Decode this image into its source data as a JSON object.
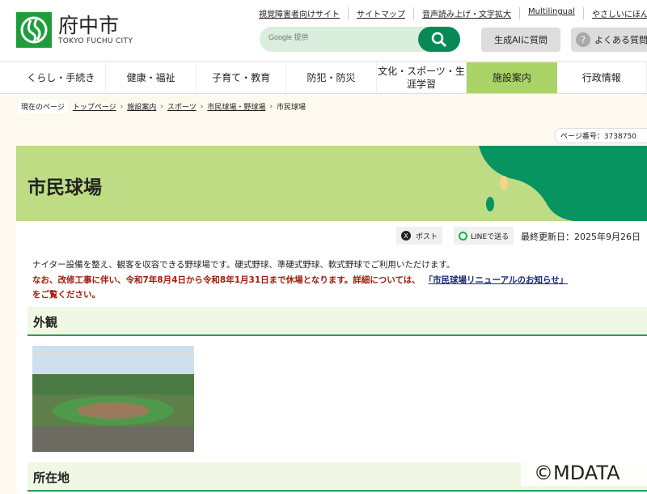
{
  "header": {
    "logo_name": "府中市",
    "logo_sub": "TOKYO FUCHU CITY",
    "util_links": [
      "視覚障害者向けサイト",
      "サイトマップ",
      "音声読み上げ・文字拡大",
      "Multilingual",
      "やさしいにほんご"
    ],
    "search_placeholder": "Google 提供",
    "ai_button": "生成AIに質問",
    "faq_button": "よくある質問",
    "faq_icon": "?"
  },
  "nav": [
    "くらし・手続き",
    "健康・福祉",
    "子育て・教育",
    "防犯・防災",
    "文化・スポーツ・生涯学習",
    "施設案内",
    "行政情報"
  ],
  "breadcrumb": {
    "label": "現在のページ",
    "items": [
      "トップページ",
      "施設案内",
      "スポーツ",
      "市民球場・野球場"
    ],
    "current": "市民球場"
  },
  "page_number": "ページ番号：3738750",
  "title": "市民球場",
  "share": {
    "x_icon": "X",
    "post": "ポスト",
    "line": "LINEで送る"
  },
  "updated": "最終更新日：2025年9月26日",
  "body": {
    "p1": "ナイター設備を整え、観客を収容できる野球場です。硬式野球、準硬式野球、軟式野球でご利用いただけます。",
    "p2a": "なお、改修工事に伴い、令和7年8月4日から令和8年1月31日まで休場となります。詳細については、",
    "p2_link": "「市民球場リニューアルのお知らせ」",
    "p2b": "をご覧ください。"
  },
  "sections": [
    "外観",
    "所在地"
  ],
  "watermark": "©MDATA",
  "colors": {
    "green": "#078a55",
    "nav_active": "#a9d466",
    "banner": "#bddc84",
    "alert": "#a11d0c"
  }
}
